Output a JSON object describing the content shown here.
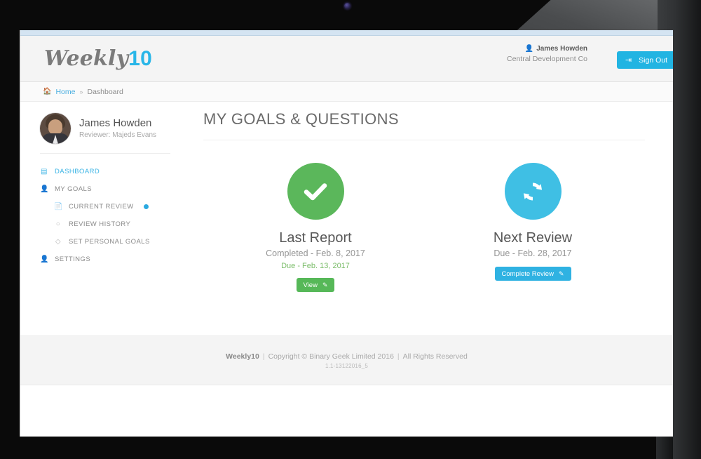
{
  "header": {
    "brand_word": "Weekly",
    "brand_number": "10",
    "user_icon": "user-icon",
    "user_name": "James Howden",
    "organisation": "Central Development Co",
    "signout_icon": "signout-icon",
    "signout_label": "Sign Out"
  },
  "breadcrumb": {
    "home_icon": "home-icon",
    "home_label": "Home",
    "separator": "»",
    "current_label": "Dashboard"
  },
  "sidebar": {
    "profile": {
      "avatar": "user-avatar-photo",
      "name": "James Howden",
      "reviewer_line": "Reviewer: Majeds Evans"
    },
    "items": [
      {
        "label": "DASHBOARD",
        "icon": "dashboard-icon",
        "active": true,
        "sub": false,
        "dot": false
      },
      {
        "label": "MY GOALS",
        "icon": "user-icon",
        "active": false,
        "sub": false,
        "dot": false
      },
      {
        "label": "CURRENT REVIEW",
        "icon": "document-icon",
        "active": false,
        "sub": true,
        "dot": true
      },
      {
        "label": "REVIEW HISTORY",
        "icon": "clock-icon",
        "active": false,
        "sub": true,
        "dot": false
      },
      {
        "label": "SET PERSONAL GOALS",
        "icon": "diamond-icon",
        "active": false,
        "sub": true,
        "dot": false
      },
      {
        "label": "SETTINGS",
        "icon": "user-icon",
        "active": false,
        "sub": false,
        "dot": false
      }
    ]
  },
  "main": {
    "page_title": "MY GOALS & QUESTIONS",
    "cards": [
      {
        "icon": "check-icon",
        "circle_color": "#5bb75b",
        "title": "Last Report",
        "line1": "Completed - Feb. 8, 2017",
        "line2": "Due - Feb. 13, 2017",
        "button_label": "View",
        "button_icon": "edit-icon",
        "button_color": "#56b858"
      },
      {
        "icon": "refresh-icon",
        "circle_color": "#3fbfe4",
        "title": "Next Review",
        "line1": "Due - Feb. 28, 2017",
        "line2": "",
        "button_label": "Complete Review",
        "button_icon": "edit-icon",
        "button_color": "#2fb2e2"
      }
    ]
  },
  "footer": {
    "brand": "Weekly10",
    "pipe1": "|",
    "copyright": "Copyright © Binary Geek Limited 2016",
    "pipe2": "|",
    "rights": "All Rights Reserved",
    "version": "1.1-13122016_5"
  }
}
